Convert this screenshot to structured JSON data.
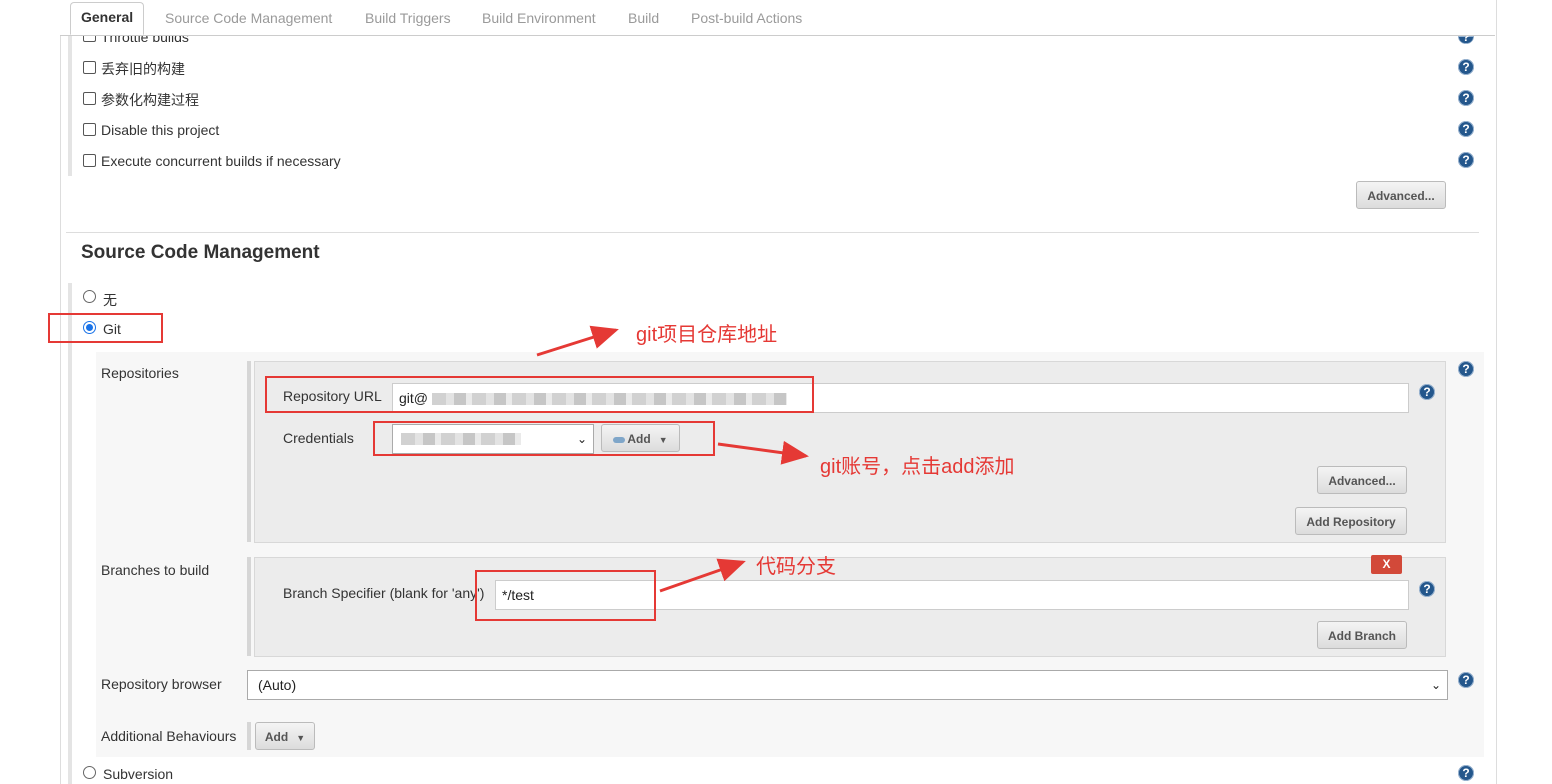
{
  "tabs": [
    {
      "label": "General",
      "active": true
    },
    {
      "label": "Source Code Management"
    },
    {
      "label": "Build Triggers"
    },
    {
      "label": "Build Environment"
    },
    {
      "label": "Build"
    },
    {
      "label": "Post-build Actions"
    }
  ],
  "general": {
    "options": [
      "Throttle builds",
      "丢弃旧的构建",
      "参数化构建过程",
      "Disable this project",
      "Execute concurrent builds if necessary"
    ],
    "advanced_label": "Advanced..."
  },
  "scm": {
    "heading": "Source Code Management",
    "option_none": "无",
    "option_git": "Git",
    "repositories_label": "Repositories",
    "repo_url_label": "Repository URL",
    "repo_url_value": "git@",
    "credentials_label": "Credentials",
    "credentials_add": "Add",
    "repo_advanced": "Advanced...",
    "add_repository": "Add Repository",
    "branches_label": "Branches to build",
    "branch_spec_label": "Branch Specifier (blank for 'any')",
    "branch_spec_value": "*/test",
    "delete_branch": "X",
    "add_branch": "Add Branch",
    "repo_browser_label": "Repository browser",
    "repo_browser_value": "(Auto)",
    "additional_label": "Additional Behaviours",
    "additional_add": "Add",
    "option_svn": "Subversion"
  },
  "annotations": {
    "repo_note": "git项目仓库地址",
    "cred_note": "git账号，点击add添加",
    "branch_note": "代码分支"
  },
  "colors": {
    "annotation": "#e53935",
    "help_icon": "#24578c",
    "accent": "#1a73e8"
  }
}
